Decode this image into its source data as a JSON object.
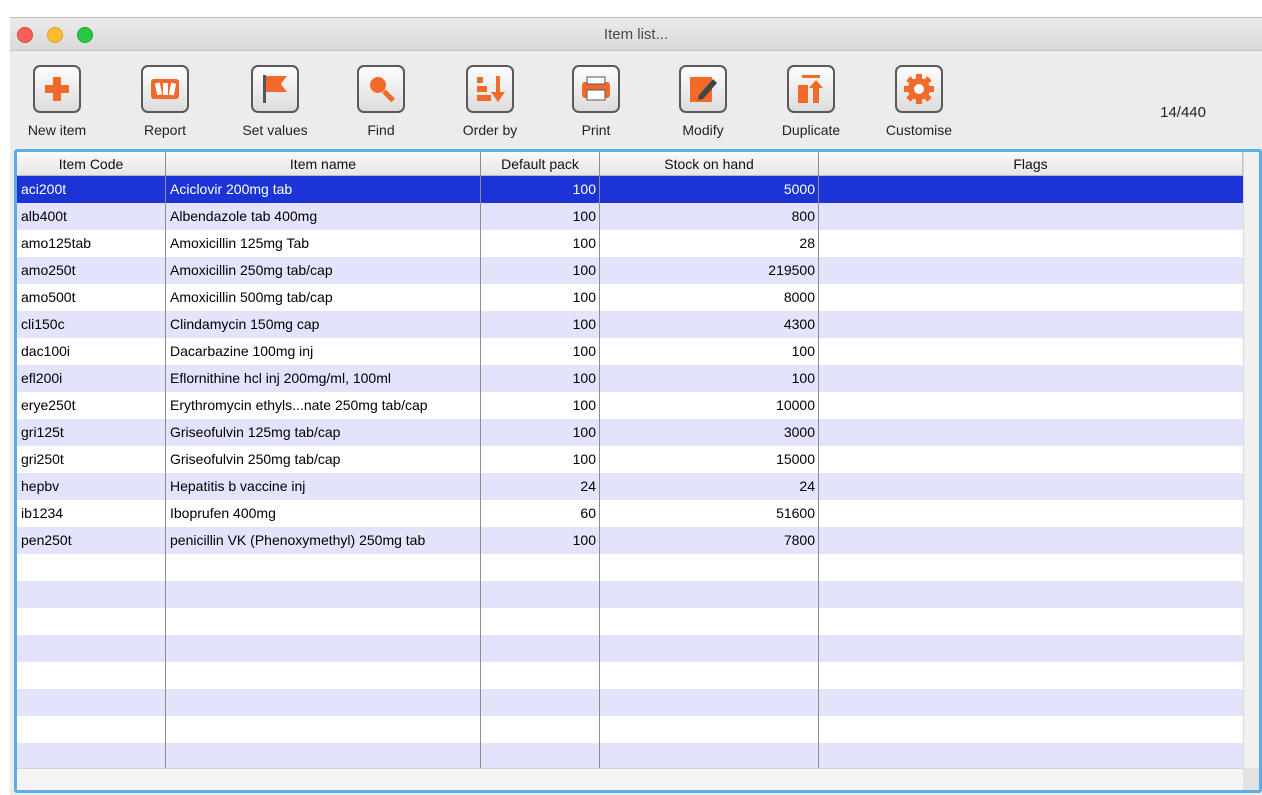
{
  "window": {
    "title": "Item list..."
  },
  "toolbar": {
    "buttons": [
      {
        "label": "New item",
        "icon": "plus-icon"
      },
      {
        "label": "Report",
        "icon": "report-icon"
      },
      {
        "label": "Set values",
        "icon": "flag-icon"
      },
      {
        "label": "Find",
        "icon": "magnifier-icon"
      },
      {
        "label": "Order by",
        "icon": "sort-icon"
      },
      {
        "label": "Print",
        "icon": "printer-icon"
      },
      {
        "label": "Modify",
        "icon": "edit-icon"
      },
      {
        "label": "Duplicate",
        "icon": "duplicate-icon"
      },
      {
        "label": "Customise",
        "icon": "gear-icon"
      }
    ],
    "record_count": "14/440"
  },
  "table": {
    "columns": [
      "Item Code",
      "Item name",
      "Default pack",
      "Stock on hand",
      "Flags"
    ],
    "rows": [
      {
        "code": "aci200t",
        "name": "Aciclovir 200mg tab",
        "pack": "100",
        "stock": "5000",
        "flags": ""
      },
      {
        "code": "alb400t",
        "name": "Albendazole tab 400mg",
        "pack": "100",
        "stock": "800",
        "flags": ""
      },
      {
        "code": "amo125tab",
        "name": "Amoxicillin 125mg Tab",
        "pack": "100",
        "stock": "28",
        "flags": ""
      },
      {
        "code": "amo250t",
        "name": "Amoxicillin 250mg tab/cap",
        "pack": "100",
        "stock": "219500",
        "flags": ""
      },
      {
        "code": "amo500t",
        "name": "Amoxicillin 500mg tab/cap",
        "pack": "100",
        "stock": "8000",
        "flags": ""
      },
      {
        "code": "cli150c",
        "name": "Clindamycin 150mg cap",
        "pack": "100",
        "stock": "4300",
        "flags": ""
      },
      {
        "code": "dac100i",
        "name": "Dacarbazine 100mg inj",
        "pack": "100",
        "stock": "100",
        "flags": ""
      },
      {
        "code": "efl200i",
        "name": "Eflornithine hcl inj 200mg/ml, 100ml",
        "pack": "100",
        "stock": "100",
        "flags": ""
      },
      {
        "code": "erye250t",
        "name": "Erythromycin ethyls...nate 250mg tab/cap",
        "pack": "100",
        "stock": "10000",
        "flags": ""
      },
      {
        "code": "gri125t",
        "name": "Griseofulvin 125mg tab/cap",
        "pack": "100",
        "stock": "3000",
        "flags": ""
      },
      {
        "code": "gri250t",
        "name": "Griseofulvin 250mg tab/cap",
        "pack": "100",
        "stock": "15000",
        "flags": ""
      },
      {
        "code": "hepbv",
        "name": "Hepatitis b vaccine inj",
        "pack": "24",
        "stock": "24",
        "flags": ""
      },
      {
        "code": "ib1234",
        "name": "Iboprufen 400mg",
        "pack": "60",
        "stock": "51600",
        "flags": ""
      },
      {
        "code": "pen250t",
        "name": "penicillin VK (Phenoxymethyl) 250mg tab",
        "pack": "100",
        "stock": "7800",
        "flags": ""
      }
    ],
    "selected_row": 0
  },
  "colors": {
    "selection": "#1c34d6",
    "row_stripe": "#e3e4fb",
    "focus_ring": "#5aaee8",
    "icon_accent": "#f26a2a"
  }
}
